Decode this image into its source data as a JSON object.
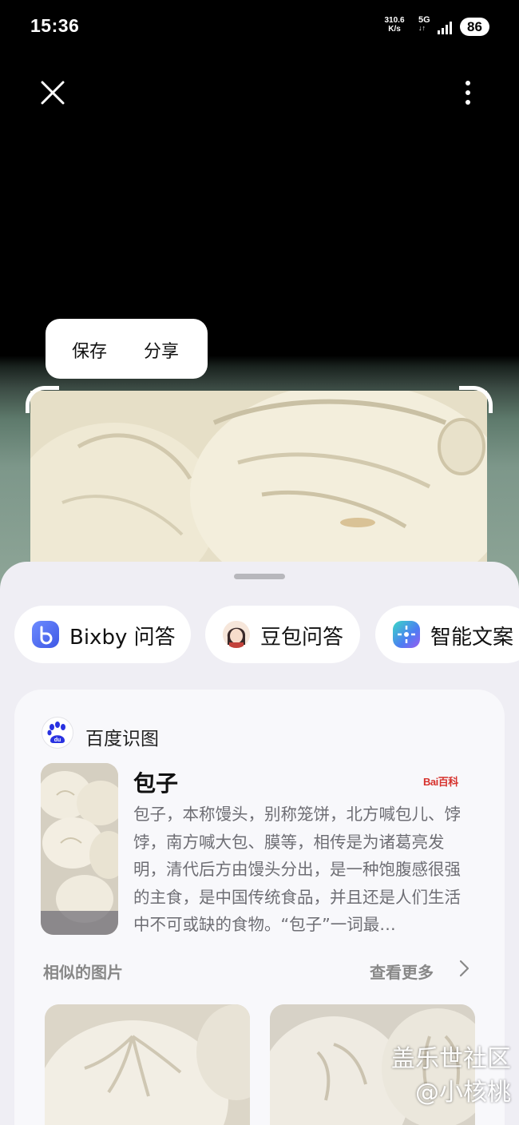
{
  "status_bar": {
    "time": "15:36",
    "net_speed_value": "310.6",
    "net_speed_unit": "K/s",
    "network": "5G",
    "battery": "86"
  },
  "toolbar": {
    "close_icon": "close-icon",
    "more_icon": "more-vertical-icon"
  },
  "image_actions": {
    "save_label": "保存",
    "share_label": "分享"
  },
  "chips": [
    {
      "label": "Bixby 问答",
      "icon": "bixby-icon"
    },
    {
      "label": "豆包问答",
      "icon": "doubao-avatar-icon"
    },
    {
      "label": "智能文案",
      "icon": "smart-copy-icon"
    }
  ],
  "result_card": {
    "source_name": "百度识图",
    "source_icon": "baidu-paw-icon",
    "title": "包子",
    "baike_logo": "Bai百科",
    "description": " 包子，本称馒头，别称笼饼，北方喊包儿、饽饽，南方喊大包、膜等，相传是为诸葛亮发明，清代后方由馒头分出，是一种饱腹感很强的主食，是中国传统食品，并且还是人们生活中不可或缺的食物。“包子”一词最…",
    "similar_label": "相似的图片",
    "see_more_label": "查看更多"
  },
  "watermark": {
    "line1": "盖乐世社区",
    "line2": "@小核桃"
  }
}
